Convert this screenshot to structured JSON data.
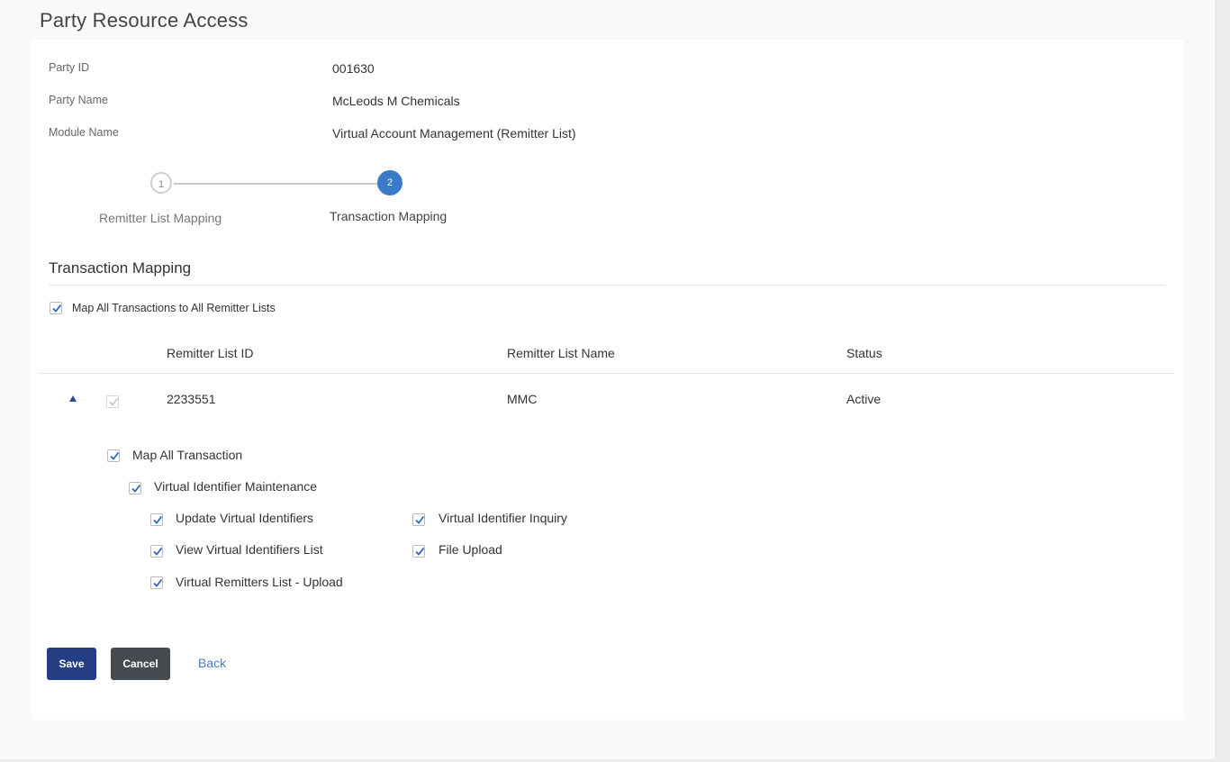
{
  "page": {
    "title": "Party Resource Access"
  },
  "party_info": [
    {
      "label": "Party ID",
      "value": "001630"
    },
    {
      "label": "Party Name",
      "value": "McLeods M Chemicals"
    },
    {
      "label": "Module Name",
      "value": "Virtual Account Management (Remitter List)"
    }
  ],
  "stepper": {
    "steps": [
      {
        "number": "1",
        "label": "Remitter List Mapping",
        "state": "completed"
      },
      {
        "number": "2",
        "label": "Transaction Mapping",
        "state": "active"
      }
    ]
  },
  "section": {
    "title": "Transaction Mapping",
    "map_all_label": "Map All Transactions to All Remitter Lists",
    "map_all_checked": true
  },
  "table": {
    "columns": [
      "Remitter List ID",
      "Remitter List Name",
      "Status"
    ],
    "rows": [
      {
        "id": "2233551",
        "name": "MMC",
        "status": "Active",
        "checked": true,
        "expanded": true
      }
    ]
  },
  "transactions": {
    "map_all_label": "Map All Transaction",
    "group_label": "Virtual Identifier Maintenance",
    "items": [
      {
        "label": "Update Virtual Identifiers",
        "checked": true
      },
      {
        "label": "Virtual Identifier Inquiry",
        "checked": true
      },
      {
        "label": "View Virtual Identifiers List",
        "checked": true
      },
      {
        "label": "File Upload",
        "checked": true
      },
      {
        "label": "Virtual Remitters List - Upload",
        "checked": true
      }
    ]
  },
  "actions": {
    "save": "Save",
    "cancel": "Cancel",
    "back": "Back"
  },
  "colors": {
    "primary": "#233e82",
    "secondary": "#464b52",
    "step_active": "#3a7bc8",
    "check": "#2b66b8",
    "link": "#4a7cc0"
  }
}
